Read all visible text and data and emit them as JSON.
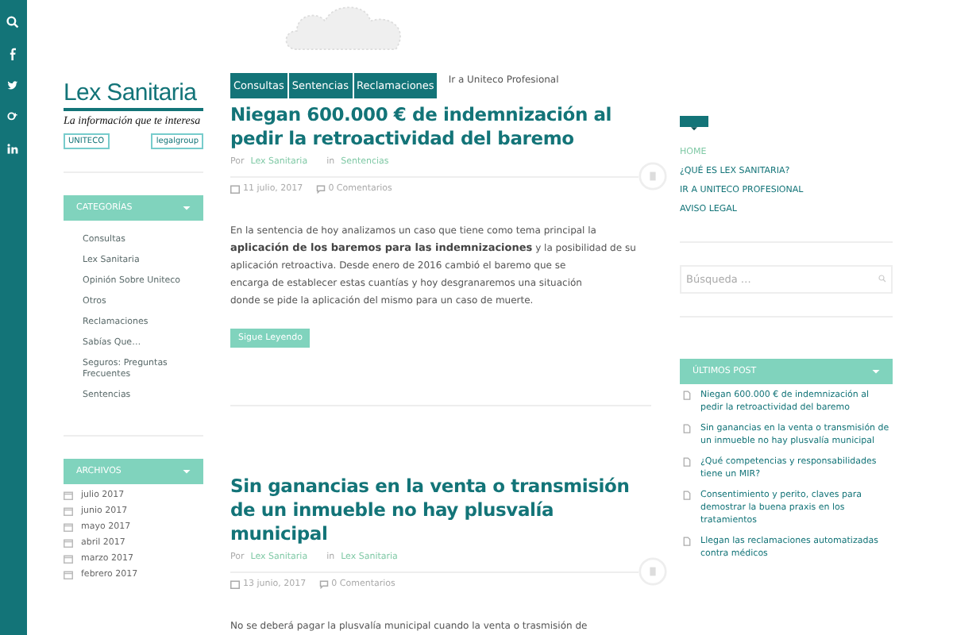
{
  "logo": {
    "title": "Lex Sanitaria",
    "tagline": "La información que te interesa",
    "partners": [
      "UNITECO",
      "legalgroup"
    ]
  },
  "categories": {
    "heading": "CATEGORÍAS",
    "items": [
      "Consultas",
      "Lex Sanitaria",
      "Opinión Sobre Uniteco",
      "Otros",
      "Reclamaciones",
      "Sabías Que…",
      "Seguros: Preguntas Frecuentes",
      "Sentencias"
    ]
  },
  "archives": {
    "heading": "ARCHIVOS",
    "items": [
      "julio 2017",
      "junio 2017",
      "mayo 2017",
      "abril 2017",
      "marzo 2017",
      "febrero 2017"
    ]
  },
  "top_tags": [
    "Consultas",
    "Sentencias",
    "Reclamaciones"
  ],
  "top_link": "Ir a Uniteco Profesional",
  "posts": [
    {
      "title": "Niegan 600.000 € de indemnización al pedir la retroactividad del baremo",
      "by_label": "Por",
      "author": "Lex Sanitaria",
      "in_label": "in",
      "category": "Sentencias",
      "date": "11 julio, 2017",
      "comments": "0 Comentarios",
      "excerpt": [
        "En la sentencia de hoy analizamos un caso que tiene como tema principal la",
        "**aplicación de los baremos para las indemnizaciones** y la posibilidad de su",
        "aplicación retroactiva. Desde enero de 2016 cambió el baremo que se",
        "encarga de establecer estas cuantías y hoy desgranaremos una situación",
        "donde se pide la aplicación del mismo para un caso de muerte."
      ],
      "button": "Sigue Leyendo"
    },
    {
      "title": "Sin ganancias en la venta o transmisión de un inmueble no hay plusvalía municipal",
      "by_label": "Por",
      "author": "Lex Sanitaria",
      "in_label": "in",
      "category": "Lex Sanitaria",
      "date": "13 junio, 2017",
      "comments": "0 Comentarios",
      "excerpt": [
        "No se deberá pagar la plusvalía municipal cuando la venta o trasmisión de"
      ]
    }
  ],
  "menu": {
    "items": [
      {
        "label": "HOME",
        "selected": true
      },
      {
        "label": "¿QUÉ ES LEX SANITARIA?",
        "selected": false
      },
      {
        "label": "IR A UNITECO PROFESIONAL",
        "selected": false
      },
      {
        "label": "AVISO LEGAL",
        "selected": false
      }
    ]
  },
  "search": {
    "placeholder": "Búsqueda …"
  },
  "latest": {
    "heading": "ÚLTIMOS POST",
    "items": [
      "Niegan 600.000 € de indemnización al pedir la retroactividad del baremo",
      "Sin ganancias en la venta o transmisión de un inmueble no hay plusvalía municipal",
      "¿Qué competencias y responsabilidades tiene un MIR?",
      "Consentimiento y perito, claves para demostrar la buena praxis en los tratamientos",
      "Llegan las reclamaciones automatizadas contra médicos"
    ]
  }
}
